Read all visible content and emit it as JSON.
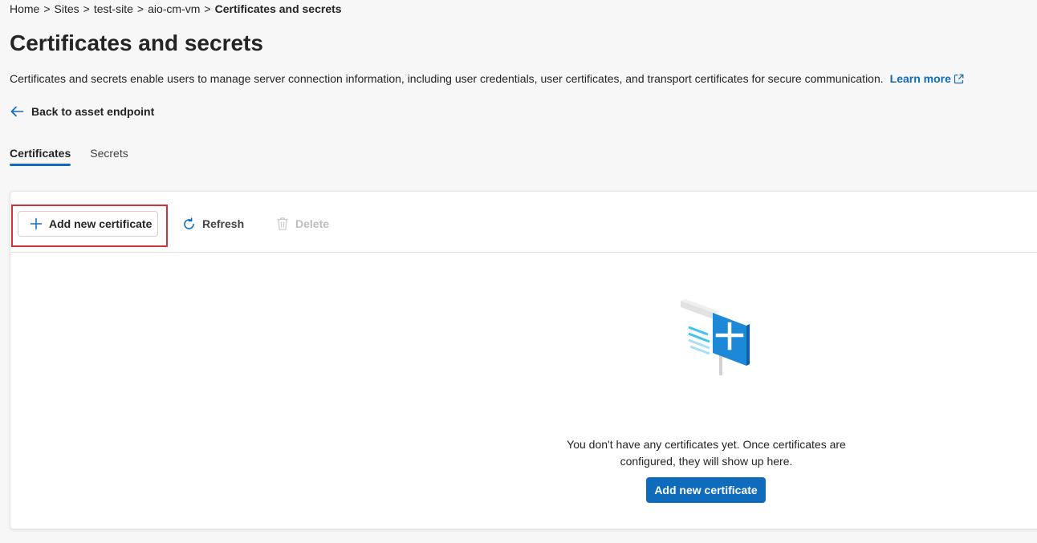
{
  "breadcrumb": {
    "items": [
      "Home",
      "Sites",
      "test-site",
      "aio-cm-vm"
    ],
    "current": "Certificates and secrets",
    "separator": ">"
  },
  "page": {
    "title": "Certificates and secrets",
    "description": "Certificates and secrets enable users to manage server connection information, including user credentials, user certificates, and transport certificates for secure communication.",
    "learn_more": "Learn more",
    "back_link": "Back to asset endpoint"
  },
  "tabs": [
    {
      "label": "Certificates",
      "active": true
    },
    {
      "label": "Secrets",
      "active": false
    }
  ],
  "toolbar": {
    "add_label": "Add new certificate",
    "refresh_label": "Refresh",
    "delete_label": "Delete"
  },
  "empty_state": {
    "message": "You don't have any certificates yet. Once certificates are configured, they will show up here.",
    "button_label": "Add new certificate"
  },
  "icons": {
    "learn_more": "open-external-icon",
    "back": "arrow-left-icon",
    "add": "plus-icon",
    "refresh": "refresh-icon",
    "delete": "trash-icon",
    "illustration": "certificate-illustration"
  },
  "colors": {
    "accent": "#0f6cbd",
    "highlight": "#d13438",
    "disabled": "#bdbdbd"
  }
}
